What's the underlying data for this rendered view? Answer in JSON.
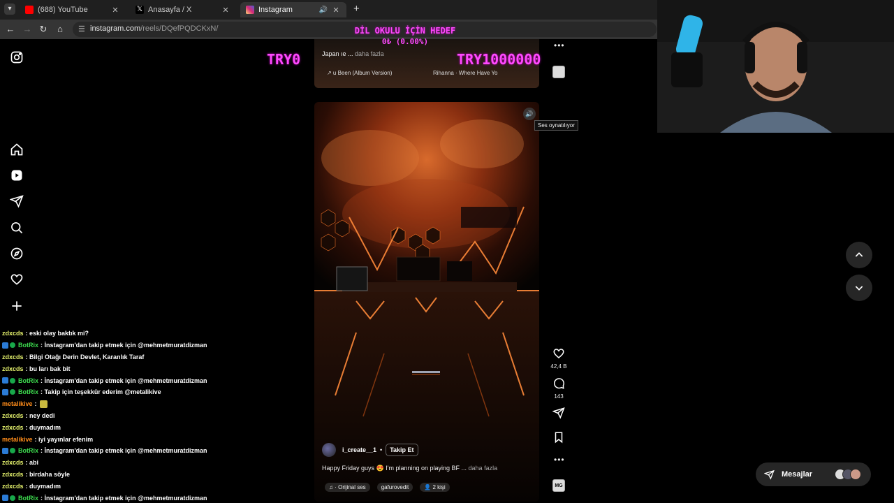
{
  "browser": {
    "tabs": [
      {
        "title": "(688) YouTube",
        "favicon_color": "#ff0000"
      },
      {
        "title": "Anasayfa / X",
        "favicon_color": "#000000"
      },
      {
        "title": "Instagram",
        "favicon_color": "#d62976"
      }
    ],
    "url_host": "instagram.com",
    "url_path": "/reels/DQefPQDCKxN/"
  },
  "overlay_goal": {
    "title": "DİL OKULU İÇİN HEDEF",
    "percent": "0₺ (0.00%)",
    "current": "TRY0",
    "target": "TRY1000000"
  },
  "sidebar": {
    "icons": [
      "instagram-logo-icon",
      "home-icon",
      "reels-icon",
      "send-icon",
      "search-icon",
      "explore-icon",
      "heart-icon",
      "create-icon"
    ]
  },
  "prev_reel": {
    "caption": "Japan ıe ...",
    "more": "daha fazla",
    "audio": "↗ u Been (Album Version)",
    "song": "Rihanna · Where Have Yo"
  },
  "reel": {
    "mute_tooltip": "Ses oynatılıyor",
    "username": "i_create__1",
    "separator": "•",
    "follow_label": "Takip Et",
    "caption": "Happy Friday guys 😍 I'm planning on playing BF ...",
    "more": "daha fazla",
    "audio_label": "♫ · Orijinal ses",
    "audio_user": "gafurovedit",
    "people_label": "👤 2 kişi"
  },
  "actions": {
    "likes": "42,4 B",
    "comments": "143",
    "audio_thumb_text": "MG"
  },
  "messages": {
    "label": "Mesajlar"
  },
  "chat": [
    {
      "user": "zdxcds",
      "color": "#e8f56e",
      "text": ": eski olay baktık mi?",
      "badges": false
    },
    {
      "user": "BotRix",
      "color": "#3ddc4f",
      "text": ": İnstagram'dan takip etmek için @mehmetmuratdizman",
      "badges": true
    },
    {
      "user": "zdxcds",
      "color": "#e8f56e",
      "text": ": Bilgi Otağı Derin Devlet, Karanlık Taraf",
      "badges": false
    },
    {
      "user": "zdxcds",
      "color": "#e8f56e",
      "text": ": bu ları bak bit",
      "badges": false
    },
    {
      "user": "BotRix",
      "color": "#3ddc4f",
      "text": ": İnstagram'dan takip etmek için @mehmetmuratdizman",
      "badges": true
    },
    {
      "user": "BotRix",
      "color": "#3ddc4f",
      "text": ": Takip için teşekkür ederim @metalikive",
      "badges": true
    },
    {
      "user": "metalikive",
      "color": "#ff8c1a",
      "text": ":",
      "badges": false,
      "emote": true
    },
    {
      "user": "zdxcds",
      "color": "#e8f56e",
      "text": ": ney dedi",
      "badges": false
    },
    {
      "user": "zdxcds",
      "color": "#e8f56e",
      "text": ": duymadım",
      "badges": false
    },
    {
      "user": "metalikive",
      "color": "#ff8c1a",
      "text": ": iyi yayınlar efenim",
      "badges": false
    },
    {
      "user": "BotRix",
      "color": "#3ddc4f",
      "text": ": İnstagram'dan takip etmek için @mehmetmuratdizman",
      "badges": true
    },
    {
      "user": "zdxcds",
      "color": "#e8f56e",
      "text": ": abi",
      "badges": false
    },
    {
      "user": "zdxcds",
      "color": "#e8f56e",
      "text": ": birdaha söyle",
      "badges": false
    },
    {
      "user": "zdxcds",
      "color": "#e8f56e",
      "text": ": duymadım",
      "badges": false
    },
    {
      "user": "BotRix",
      "color": "#3ddc4f",
      "text": ": İnstagram'dan takip etmek için @mehmetmuratdizman",
      "badges": true
    }
  ],
  "colors": {
    "goal_magenta": "#ff49ff",
    "reel_glow": "#ff6a1a"
  }
}
